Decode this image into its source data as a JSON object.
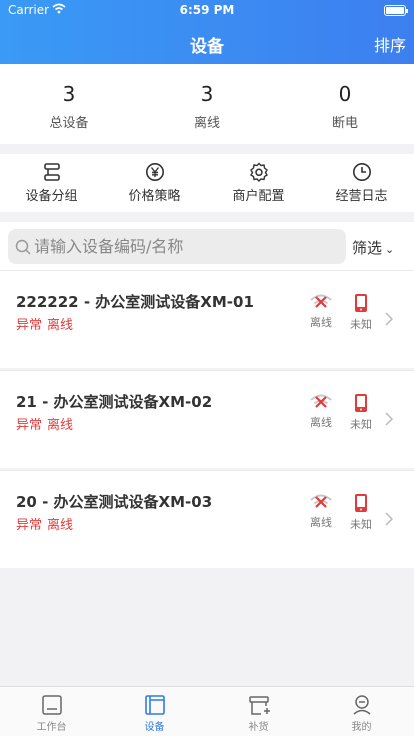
{
  "status": {
    "carrier": "Carrier",
    "time": "6:59 PM"
  },
  "header": {
    "title": "设备",
    "sort_label": "排序"
  },
  "stats": [
    {
      "value": "3",
      "label": "总设备"
    },
    {
      "value": "3",
      "label": "离线"
    },
    {
      "value": "0",
      "label": "断电"
    }
  ],
  "menu": [
    {
      "label": "设备分组",
      "icon": "group-icon"
    },
    {
      "label": "价格策略",
      "icon": "yen-icon"
    },
    {
      "label": "商户配置",
      "icon": "gear-icon"
    },
    {
      "label": "经营日志",
      "icon": "clock-icon"
    }
  ],
  "search": {
    "placeholder": "请输入设备编码/名称",
    "value": ""
  },
  "filter": {
    "label": "筛选"
  },
  "devices": [
    {
      "name": "222222 - 办公室测试设备XM-01",
      "tags": [
        "异常",
        "离线"
      ],
      "net_status": "离线",
      "power_status": "未知"
    },
    {
      "name": "21 - 办公室测试设备XM-02",
      "tags": [
        "异常",
        "离线"
      ],
      "net_status": "离线",
      "power_status": "未知"
    },
    {
      "name": "20 - 办公室测试设备XM-03",
      "tags": [
        "异常",
        "离线"
      ],
      "net_status": "离线",
      "power_status": "未知"
    }
  ],
  "tabbar": [
    {
      "label": "工作台",
      "active": false
    },
    {
      "label": "设备",
      "active": true
    },
    {
      "label": "补货",
      "active": false
    },
    {
      "label": "我的",
      "active": false
    }
  ],
  "colors": {
    "header": "#3a8ef3",
    "accent": "#2f7ae5",
    "alert": "#e23b3b"
  }
}
